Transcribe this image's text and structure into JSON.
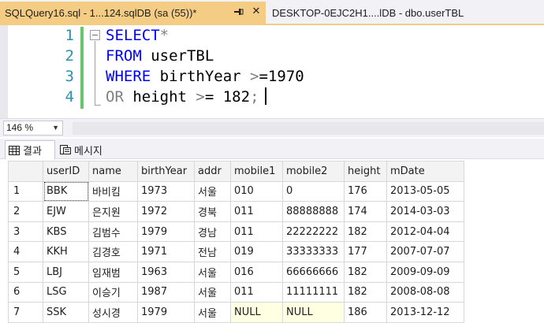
{
  "tabs": [
    {
      "label": "SQLQuery16.sql - 1...124.sqlDB (sa (55))*",
      "active": true
    },
    {
      "label": "DESKTOP-0EJC2H1....lDB - dbo.userTBL",
      "active": false
    }
  ],
  "tab_close_glyph": "✕",
  "editor": {
    "lines": [
      {
        "num": "1",
        "parts": [
          {
            "t": "SELECT",
            "c": "kw"
          },
          {
            "t": "*",
            "c": "gray"
          }
        ]
      },
      {
        "num": "2",
        "parts": [
          {
            "t": "FROM",
            "c": "kw"
          },
          {
            "t": " userTBL",
            "c": "tx"
          }
        ]
      },
      {
        "num": "3",
        "parts": [
          {
            "t": "WHERE",
            "c": "kw"
          },
          {
            "t": " birthYear ",
            "c": "tx"
          },
          {
            "t": ">",
            "c": "gray"
          },
          {
            "t": "=1970",
            "c": "tx"
          }
        ]
      },
      {
        "num": "4",
        "parts": [
          {
            "t": "OR",
            "c": "gray"
          },
          {
            "t": " height ",
            "c": "tx"
          },
          {
            "t": ">",
            "c": "gray"
          },
          {
            "t": "= 182",
            "c": "tx"
          },
          {
            "t": ";",
            "c": "gray"
          }
        ]
      }
    ]
  },
  "zoom": {
    "value": "146 %"
  },
  "result_tabs": [
    {
      "label": "결과",
      "icon": "grid-icon",
      "active": true
    },
    {
      "label": "메시지",
      "icon": "message-icon",
      "active": false
    }
  ],
  "grid": {
    "columns": [
      "",
      "userID",
      "name",
      "birthYear",
      "addr",
      "mobile1",
      "mobile2",
      "height",
      "mDate"
    ],
    "rows": [
      [
        "1",
        "BBK",
        "바비킴",
        "1973",
        "서울",
        "010",
        "0",
        "176",
        "2013-05-05"
      ],
      [
        "2",
        "EJW",
        "은지원",
        "1972",
        "경북",
        "011",
        "88888888",
        "174",
        "2014-03-03"
      ],
      [
        "3",
        "KBS",
        "김범수",
        "1979",
        "경남",
        "011",
        "22222222",
        "182",
        "2012-04-04"
      ],
      [
        "4",
        "KKH",
        "김경호",
        "1971",
        "전남",
        "019",
        "33333333",
        "177",
        "2007-07-07"
      ],
      [
        "5",
        "LBJ",
        "임재범",
        "1963",
        "서울",
        "016",
        "66666666",
        "182",
        "2009-09-09"
      ],
      [
        "6",
        "LSG",
        "이승기",
        "1987",
        "서울",
        "011",
        "11111111",
        "182",
        "2008-08-08"
      ],
      [
        "7",
        "SSK",
        "성시경",
        "1979",
        "서울",
        "NULL",
        "NULL",
        "186",
        "2013-12-12"
      ]
    ]
  },
  "colors": {
    "active_tab": "#f5cc84",
    "keyword": "#0000ff",
    "operator": "#808080",
    "line_number": "#2b91af",
    "null_cell": "#ffffe1",
    "change_bar": "#6bc56b"
  }
}
